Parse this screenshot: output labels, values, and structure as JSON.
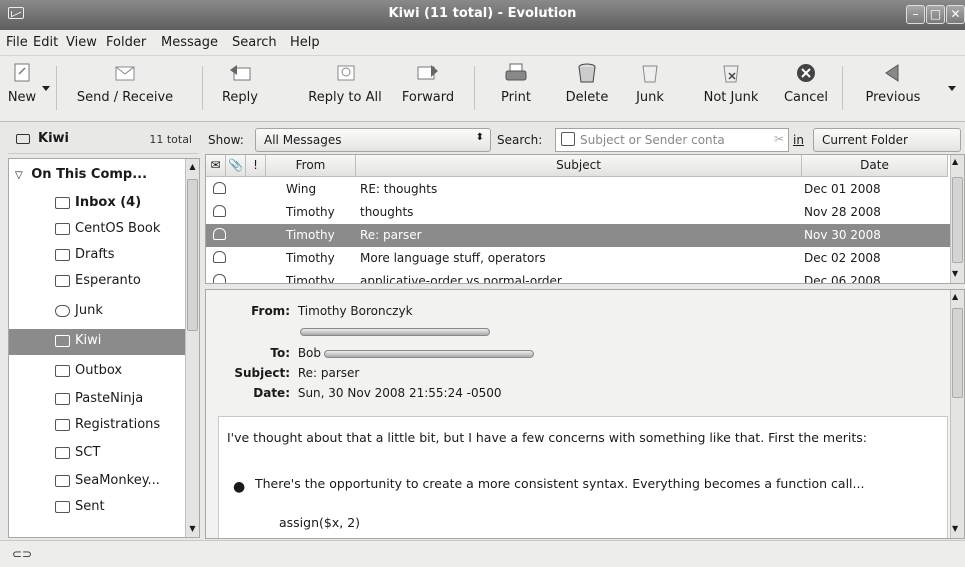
{
  "window": {
    "title": "Kiwi (11 total) - Evolution"
  },
  "menu": [
    "File",
    "Edit",
    "View",
    "Folder",
    "Message",
    "Search",
    "Help"
  ],
  "toolbar": {
    "new": "New",
    "send_receive": "Send / Receive",
    "reply": "Reply",
    "reply_all": "Reply to All",
    "forward": "Forward",
    "print": "Print",
    "delete": "Delete",
    "junk": "Junk",
    "not_junk": "Not Junk",
    "cancel": "Cancel",
    "previous": "Previous"
  },
  "folder_header": {
    "name": "Kiwi",
    "total": "11 total"
  },
  "sidebar": {
    "root": "On This Comp...",
    "folders": [
      {
        "label": "Inbox (4)",
        "icon": "inbox-icon"
      },
      {
        "label": "CentOS Book",
        "icon": "folder-icon"
      },
      {
        "label": "Drafts",
        "icon": "drafts-icon"
      },
      {
        "label": "Esperanto",
        "icon": "folder-icon"
      },
      {
        "label": "Junk",
        "icon": "junk-icon"
      },
      {
        "label": "Kiwi",
        "icon": "folder-icon"
      },
      {
        "label": "Outbox",
        "icon": "outbox-icon"
      },
      {
        "label": "PasteNinja",
        "icon": "folder-icon"
      },
      {
        "label": "Registrations",
        "icon": "folder-icon"
      },
      {
        "label": "SCT",
        "icon": "folder-icon"
      },
      {
        "label": "SeaMonkey...",
        "icon": "folder-icon"
      },
      {
        "label": "Sent",
        "icon": "sent-icon"
      }
    ]
  },
  "filter": {
    "show_label": "Show:",
    "show_value": "All Messages",
    "search_label": "Search:",
    "search_placeholder": "Subject or Sender conta",
    "in_label": "in",
    "scope_value": "Current Folder"
  },
  "message_list": {
    "columns": {
      "from": "From",
      "subject": "Subject",
      "date": "Date"
    },
    "rows": [
      {
        "from": "Wing",
        "subject": "RE: thoughts",
        "date": "Dec 01 2008"
      },
      {
        "from": "Timothy",
        "subject": "thoughts",
        "date": "Nov 28 2008"
      },
      {
        "from": "Timothy",
        "subject": "Re: parser",
        "date": "Nov 30 2008"
      },
      {
        "from": "Timothy",
        "subject": "More language stuff, operators",
        "date": "Dec 02 2008"
      },
      {
        "from": "Timothy",
        "subject": "applicative-order vs normal-order",
        "date": "Dec 06 2008"
      }
    ]
  },
  "preview": {
    "from_label": "From:",
    "from_value": "Timothy Boronczyk",
    "to_label": "To:",
    "to_value": "Bob",
    "subject_label": "Subject:",
    "subject_value": "Re: parser",
    "date_label": "Date:",
    "date_value": "Sun, 30 Nov 2008 21:55:24 -0500",
    "body_para": "I've thought about that a little bit, but I have a few concerns with something like that.  First the merits:",
    "bullet": "There's the opportunity to create a more consistent syntax.  Everything becomes a function call...",
    "code": "assign($x, 2)"
  }
}
